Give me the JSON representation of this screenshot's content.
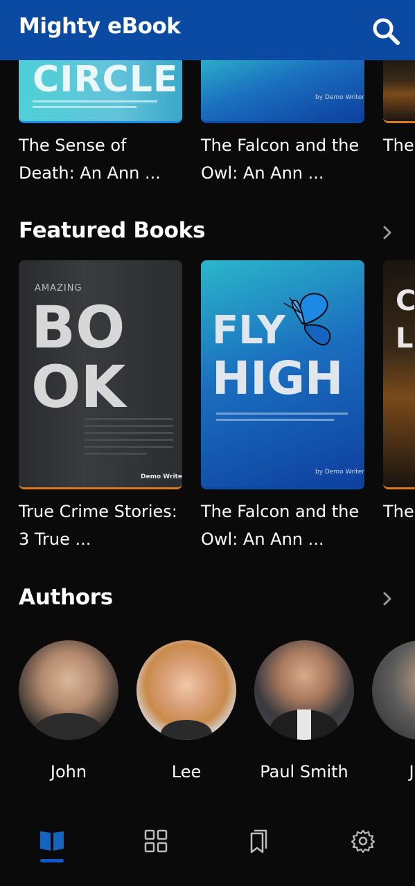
{
  "app": {
    "title": "Mighty eBook"
  },
  "top_row": {
    "books": [
      {
        "title": "The Sense of Death: An Ann ...",
        "cover_word": "CIRCLE"
      },
      {
        "title": "The Falcon and the Owl: An Ann ...",
        "cover_author": "by Demo Writer"
      },
      {
        "title": "The Bus"
      }
    ]
  },
  "featured": {
    "heading": "Featured Books",
    "books": [
      {
        "title": "True Crime Stories: 3 True ...",
        "cover_kicker": "AMAZING",
        "cover_line1": "BO",
        "cover_line2": "OK",
        "cover_author": "Demo Writer"
      },
      {
        "title": "The Falcon and the Owl: An Ann ...",
        "cover_line1": "FLY",
        "cover_line2": "HIGH",
        "cover_author": "by Demo Writer"
      },
      {
        "title": "The Bus",
        "cover_line1": "C",
        "cover_line2": "L"
      }
    ]
  },
  "authors": {
    "heading": "Authors",
    "items": [
      {
        "name": "John"
      },
      {
        "name": "Lee"
      },
      {
        "name": "Paul Smith"
      },
      {
        "name": "Jan"
      }
    ]
  },
  "bottom_nav": {
    "items": [
      {
        "icon": "book-open-icon",
        "active": true
      },
      {
        "icon": "grid-icon",
        "active": false
      },
      {
        "icon": "bookmarks-icon",
        "active": false
      },
      {
        "icon": "gear-icon",
        "active": false
      }
    ]
  },
  "colors": {
    "appbar": "#0b4aa2",
    "background": "#0a0a0a",
    "accent": "#0b5bd0"
  }
}
